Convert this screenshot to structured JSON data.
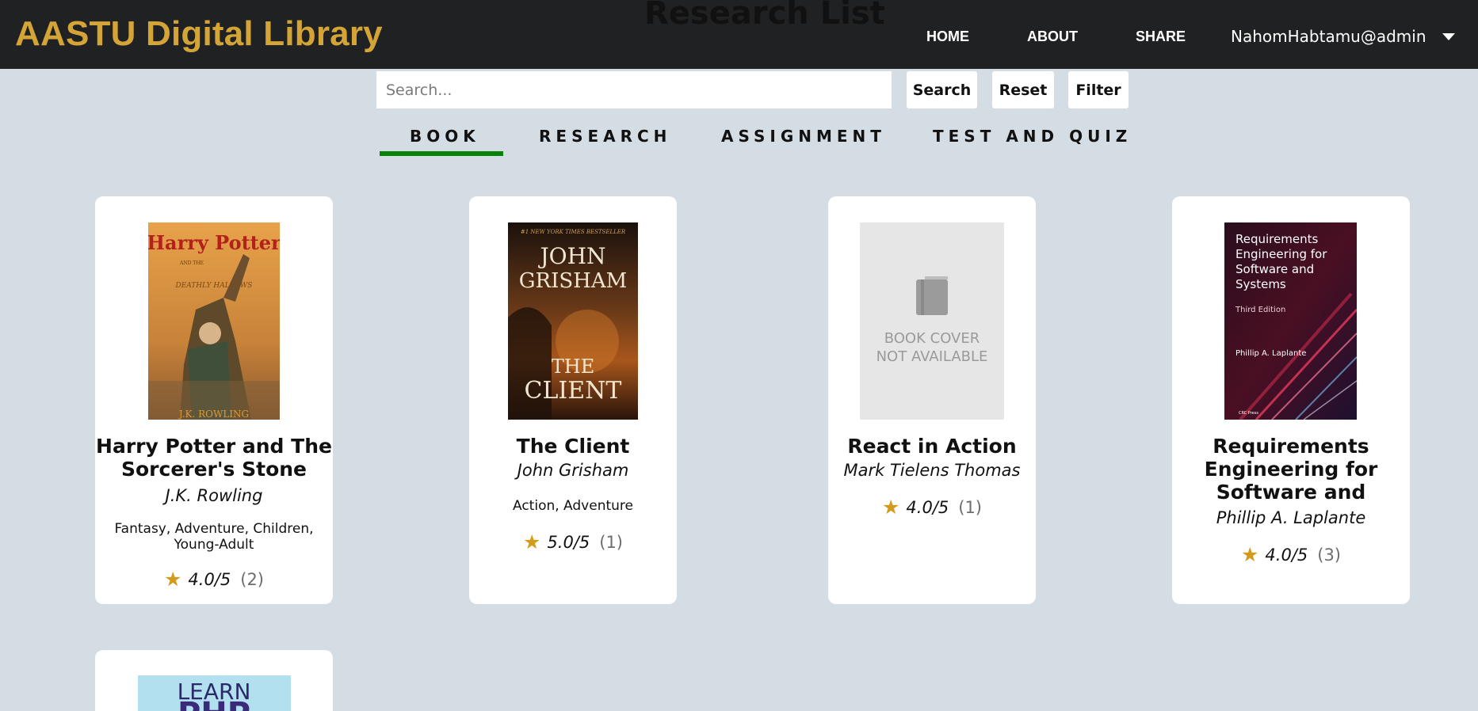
{
  "header": {
    "brand": "AASTU Digital Library",
    "page_heading": "Research List",
    "nav": [
      "HOME",
      "ABOUT",
      "SHARE"
    ],
    "user": "NahomHabtamu@admin"
  },
  "search": {
    "placeholder": "Search...",
    "value": "",
    "search_label": "Search",
    "reset_label": "Reset",
    "filter_label": "Filter"
  },
  "tabs": [
    {
      "label": "BOOK",
      "active": true
    },
    {
      "label": "RESEARCH",
      "active": false
    },
    {
      "label": "ASSIGNMENT",
      "active": false
    },
    {
      "label": "TEST AND QUIZ",
      "active": false
    }
  ],
  "colors": {
    "brand": "#d4a437",
    "active_tab": "#098209",
    "star": "#d49b1b",
    "header_bg": "#202122",
    "page_bg": "#d5dde4"
  },
  "cards": [
    {
      "title": "Harry Potter and The Sorcerer's Stone",
      "author": "J.K. Rowling",
      "genres": "Fantasy, Adventure, Children, Young-Adult",
      "score": "4.0/5",
      "count": "(2)",
      "cover": {
        "title_text": "Harry Potter",
        "sub_text": "AND THE",
        "sub_title": "DEATHLY HALLOWS",
        "author_text": "J.K. ROWLING"
      }
    },
    {
      "title": "The Client",
      "author": "John Grisham",
      "genres": "Action, Adventure",
      "score": "5.0/5",
      "count": "(1)",
      "cover": {
        "tagline": "#1 NEW YORK TIMES BESTSELLER",
        "author_text": "JOHN GRISHAM",
        "title_text": "THE CLIENT"
      }
    },
    {
      "title": "React in Action",
      "author": "Mark Tielens Thomas",
      "genres": "",
      "score": "4.0/5",
      "count": "(1)",
      "cover": {
        "placeholder_text": "BOOK COVER NOT AVAILABLE"
      }
    },
    {
      "title": "Requirements Engineering for Software and",
      "author": "Phillip A. Laplante",
      "genres": "",
      "score": "4.0/5",
      "count": "(3)",
      "cover": {
        "title_text": "Requirements Engineering for Software and Systems",
        "edition": "Third Edition",
        "author_text": "Phillip A. Laplante",
        "publisher": "CRC Press"
      }
    },
    {
      "cover": {
        "title_text": "LEARN",
        "sub_text": "PHP"
      }
    }
  ]
}
